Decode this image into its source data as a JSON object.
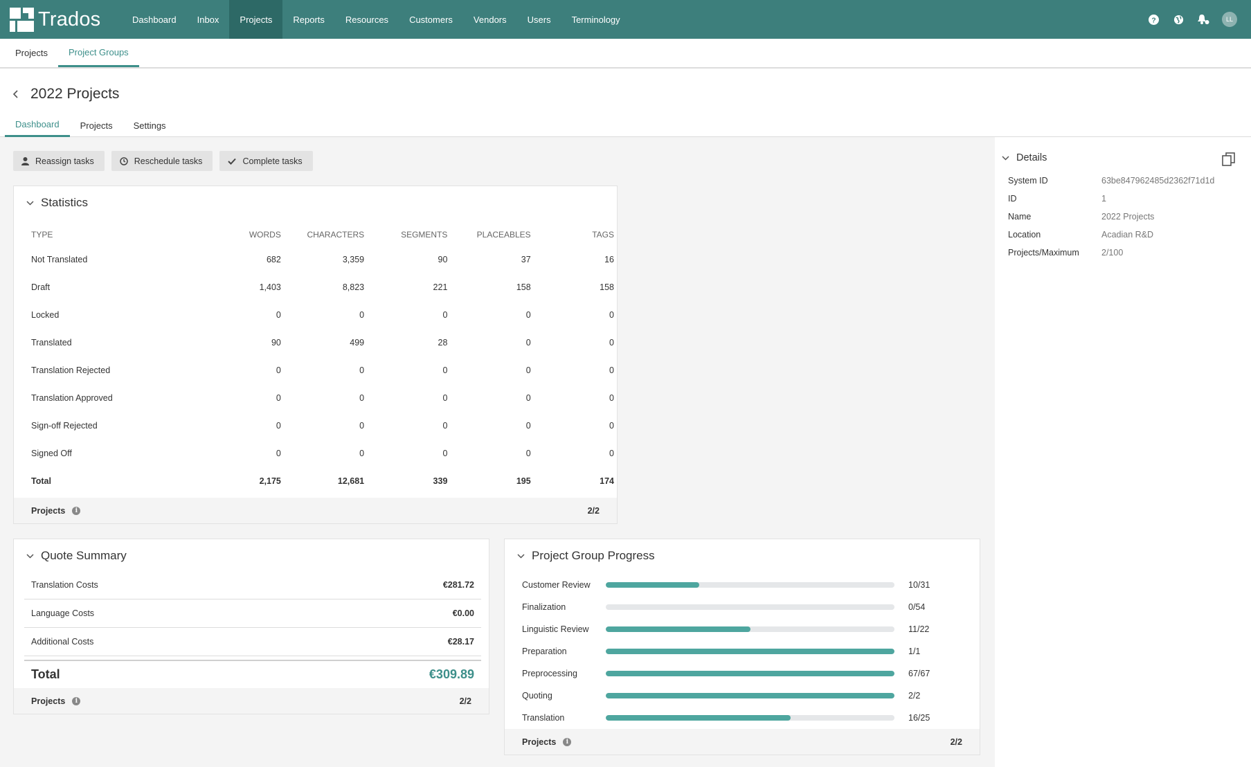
{
  "app": {
    "brand": "Trados"
  },
  "nav": {
    "items": [
      {
        "label": "Dashboard"
      },
      {
        "label": "Inbox"
      },
      {
        "label": "Projects",
        "active": true
      },
      {
        "label": "Reports"
      },
      {
        "label": "Resources"
      },
      {
        "label": "Customers"
      },
      {
        "label": "Vendors"
      },
      {
        "label": "Users"
      },
      {
        "label": "Terminology"
      }
    ],
    "avatar_initials": "LL"
  },
  "subnav": {
    "tabs": [
      {
        "label": "Projects"
      },
      {
        "label": "Project Groups",
        "active": true
      }
    ]
  },
  "header": {
    "title": "2022 Projects",
    "tabs": [
      {
        "label": "Dashboard",
        "active": true
      },
      {
        "label": "Projects"
      },
      {
        "label": "Settings"
      }
    ]
  },
  "actions": {
    "reassign": "Reassign tasks",
    "reschedule": "Reschedule tasks",
    "complete": "Complete tasks"
  },
  "statistics": {
    "title": "Statistics",
    "columns": [
      "TYPE",
      "WORDS",
      "CHARACTERS",
      "SEGMENTS",
      "PLACEABLES",
      "TAGS"
    ],
    "rows": [
      [
        "Not Translated",
        "682",
        "3,359",
        "90",
        "37",
        "16"
      ],
      [
        "Draft",
        "1,403",
        "8,823",
        "221",
        "158",
        "158"
      ],
      [
        "Locked",
        "0",
        "0",
        "0",
        "0",
        "0"
      ],
      [
        "Translated",
        "90",
        "499",
        "28",
        "0",
        "0"
      ],
      [
        "Translation Rejected",
        "0",
        "0",
        "0",
        "0",
        "0"
      ],
      [
        "Translation Approved",
        "0",
        "0",
        "0",
        "0",
        "0"
      ],
      [
        "Sign-off Rejected",
        "0",
        "0",
        "0",
        "0",
        "0"
      ],
      [
        "Signed Off",
        "0",
        "0",
        "0",
        "0",
        "0"
      ]
    ],
    "total": [
      "Total",
      "2,175",
      "12,681",
      "339",
      "195",
      "174"
    ],
    "footer_label": "Projects",
    "footer_value": "2/2"
  },
  "quote": {
    "title": "Quote Summary",
    "rows": [
      {
        "label": "Translation Costs",
        "value": "€281.72"
      },
      {
        "label": "Language Costs",
        "value": "€0.00"
      },
      {
        "label": "Additional Costs",
        "value": "€28.17"
      }
    ],
    "total_label": "Total",
    "total_value": "€309.89",
    "footer_label": "Projects",
    "footer_value": "2/2"
  },
  "progress": {
    "title": "Project Group Progress",
    "rows": [
      {
        "label": "Customer Review",
        "value": "10/31",
        "fraction": 0.3226
      },
      {
        "label": "Finalization",
        "value": "0/54",
        "fraction": 0
      },
      {
        "label": "Linguistic Review",
        "value": "11/22",
        "fraction": 0.5
      },
      {
        "label": "Preparation",
        "value": "1/1",
        "fraction": 1
      },
      {
        "label": "Preprocessing",
        "value": "67/67",
        "fraction": 1
      },
      {
        "label": "Quoting",
        "value": "2/2",
        "fraction": 1
      },
      {
        "label": "Translation",
        "value": "16/25",
        "fraction": 0.64
      }
    ],
    "footer_label": "Projects",
    "footer_value": "2/2"
  },
  "details": {
    "title": "Details",
    "rows": [
      {
        "key": "System ID",
        "value": "63be847962485d2362f71d1d"
      },
      {
        "key": "ID",
        "value": "1"
      },
      {
        "key": "Name",
        "value": "2022 Projects"
      },
      {
        "key": "Location",
        "value": "Acadian R&D"
      },
      {
        "key": "Projects/Maximum",
        "value": "2/100"
      }
    ]
  },
  "colors": {
    "topbar": "#3d7f7c",
    "accent": "#3d8f8a",
    "progress_fill": "#4ea69f"
  }
}
